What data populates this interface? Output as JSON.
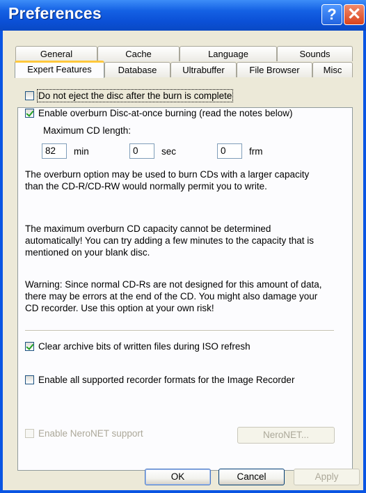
{
  "window": {
    "title": "Preferences"
  },
  "tabs_row1": [
    "General",
    "Cache",
    "Language",
    "Sounds"
  ],
  "tabs_row2": [
    "Expert Features",
    "Database",
    "Ultrabuffer",
    "File Browser",
    "Misc"
  ],
  "expert": {
    "no_eject": {
      "label": "Do not eject the disc after the burn is complete",
      "checked": false
    },
    "overburn": {
      "label": "Enable overburn Disc-at-once burning (read the notes below)",
      "checked": true
    },
    "max_cd_length_label": "Maximum CD length:",
    "min_value": "82",
    "min_unit": "min",
    "sec_value": "0",
    "sec_unit": "sec",
    "frm_value": "0",
    "frm_unit": "frm",
    "note1_line1": "The overburn option may be used to burn CDs with a larger capacity",
    "note1_line2": "than the CD-R/CD-RW would normally permit you to write.",
    "note2_line1": "The maximum overburn CD capacity cannot be determined",
    "note2_line2": "automatically! You can try adding a few minutes to the capacity that is",
    "note2_line3": "mentioned on your blank disc.",
    "warn_line1": "Warning: Since normal CD-Rs are not designed for this amount of data,",
    "warn_line2": "there may be errors at the end of the CD. You might also damage your",
    "warn_line3": "CD recorder. Use this option at your own risk!",
    "clear_archive": {
      "label": "Clear archive bits of written files during ISO refresh",
      "checked": true
    },
    "all_formats": {
      "label": "Enable all supported recorder formats for the Image Recorder",
      "checked": false
    },
    "neronet": {
      "label": "Enable NeroNET support",
      "checked": false,
      "enabled": false
    },
    "neronet_button": "NeroNET..."
  },
  "footer": {
    "ok": "OK",
    "cancel": "Cancel",
    "apply": "Apply"
  }
}
